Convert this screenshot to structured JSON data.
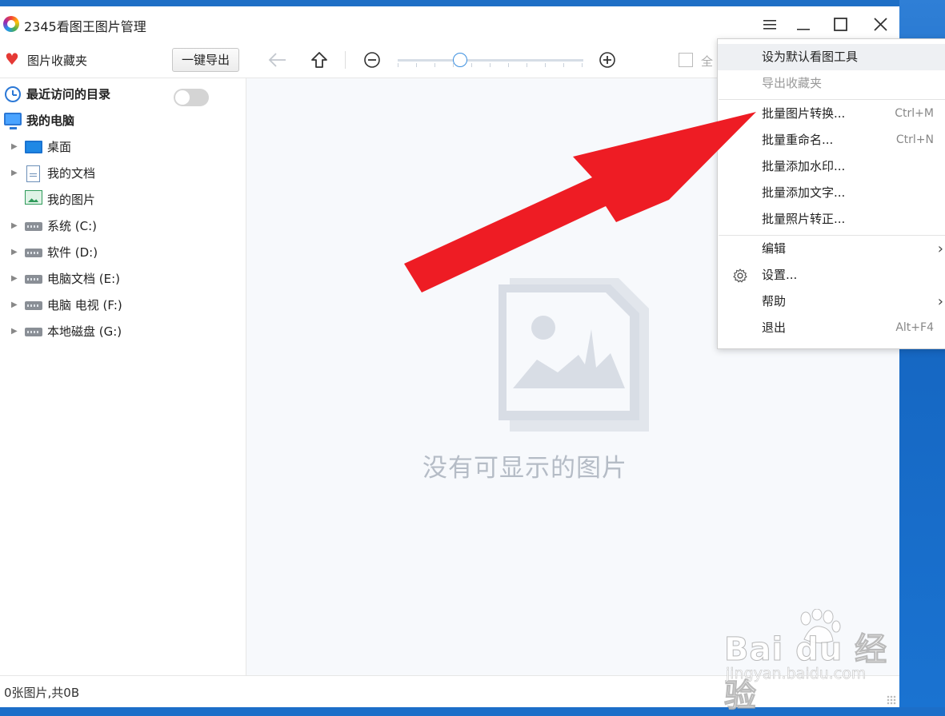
{
  "window": {
    "title": "2345看图王图片管理",
    "controls": [
      "menu-icon",
      "minimize-icon",
      "maximize-icon",
      "close-icon"
    ]
  },
  "toolbar": {
    "favorites_label": "图片收藏夹",
    "export_button": "一键导出",
    "select_all_label": "全",
    "icons": [
      "back-arrow-icon",
      "up-arrow-icon",
      "zoom-out-icon",
      "zoom-in-icon"
    ]
  },
  "sidebar": {
    "recent_label": "最近访问的目录",
    "recent_toggle": "off",
    "my_computer": "我的电脑",
    "items": [
      {
        "label": "桌面",
        "icon": "desktop-icon"
      },
      {
        "label": "我的文档",
        "icon": "document-icon"
      },
      {
        "label": "我的图片",
        "icon": "picture-icon"
      },
      {
        "label": "系统 (C:)",
        "icon": "drive-icon"
      },
      {
        "label": "软件 (D:)",
        "icon": "drive-icon"
      },
      {
        "label": "电脑文档 (E:)",
        "icon": "drive-icon"
      },
      {
        "label": "电脑 电视 (F:)",
        "icon": "drive-icon"
      },
      {
        "label": "本地磁盘 (G:)",
        "icon": "drive-icon"
      }
    ]
  },
  "main": {
    "empty_message": "没有可显示的图片"
  },
  "status": {
    "text": "0张图片,共0B"
  },
  "menu": {
    "items": [
      {
        "label": "设为默认看图工具",
        "shortcut": "",
        "highlighted": true
      },
      {
        "label": "导出收藏夹",
        "shortcut": "",
        "disabled": true
      },
      {
        "label": "批量图片转换...",
        "shortcut": "Ctrl+M"
      },
      {
        "label": "批量重命名...",
        "shortcut": "Ctrl+N"
      },
      {
        "label": "批量添加水印...",
        "shortcut": ""
      },
      {
        "label": "批量添加文字...",
        "shortcut": ""
      },
      {
        "label": "批量照片转正...",
        "shortcut": ""
      },
      {
        "label": "编辑",
        "shortcut": "",
        "submenu": true
      },
      {
        "label": "设置...",
        "shortcut": "",
        "icon": "gear-icon"
      },
      {
        "label": "帮助",
        "shortcut": "",
        "submenu": true
      },
      {
        "label": "退出",
        "shortcut": "Alt+F4"
      }
    ]
  },
  "watermark": {
    "brand": "Bai du 经验",
    "url": "jingyan.baidu.com"
  },
  "colors": {
    "accent": "#2b78d6",
    "annotation_arrow": "#ee1c24",
    "favorite_heart": "#e53935"
  }
}
